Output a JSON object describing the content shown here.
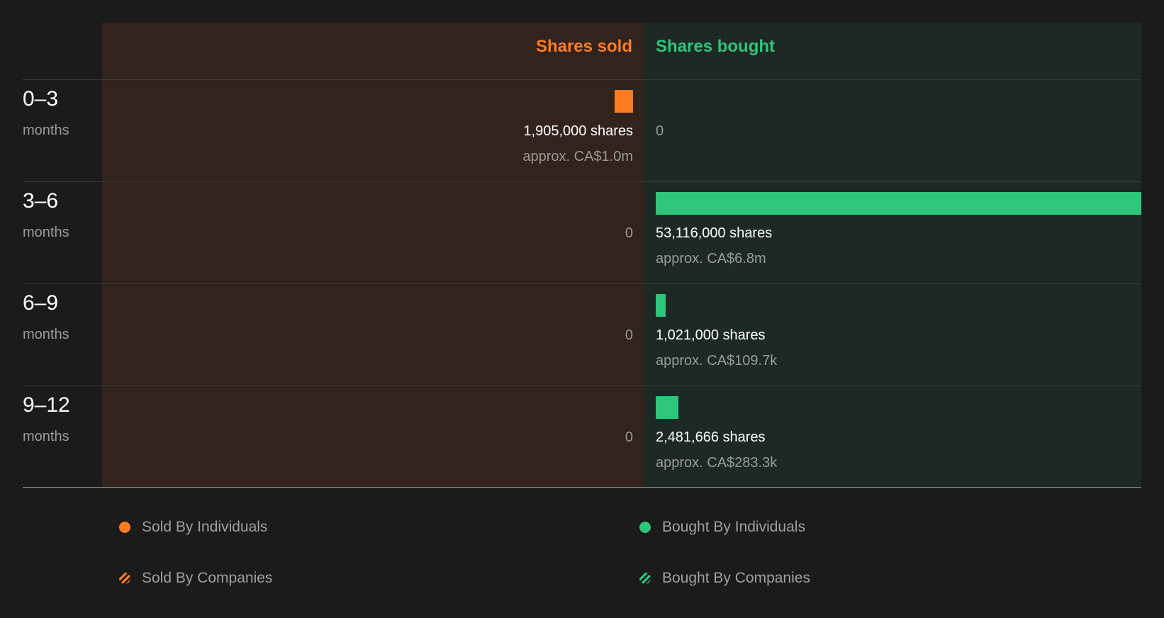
{
  "chart_data": {
    "type": "bar",
    "categories": [
      "0-3",
      "3-6",
      "6-9",
      "9-12"
    ],
    "category_unit": "months",
    "series": [
      {
        "name": "Shares sold",
        "values": [
          1905000,
          0,
          0,
          0
        ],
        "approx_values": [
          "approx. CA$1.0m",
          "",
          "",
          ""
        ]
      },
      {
        "name": "Shares bought",
        "values": [
          0,
          53116000,
          1021000,
          2481666
        ],
        "approx_values": [
          "",
          "approx. CA$6.8m",
          "approx. CA$109.7k",
          "approx. CA$283.3k"
        ]
      }
    ],
    "value_labels": {
      "sold": [
        "1,905,000 shares",
        "0",
        "0",
        "0"
      ],
      "bought": [
        "0",
        "53,116,000 shares",
        "1,021,000 shares",
        "2,481,666 shares"
      ]
    },
    "colors": {
      "sold": "#ff7b22",
      "bought": "#2ec67a",
      "sold_panel": "#32231c",
      "bought_panel": "#1c2924"
    },
    "legend": [
      {
        "label": "Sold By Individuals",
        "color": "#ff7b22",
        "style": "solid"
      },
      {
        "label": "Bought By Individuals",
        "color": "#2ec67a",
        "style": "solid"
      },
      {
        "label": "Sold By Companies",
        "color": "#ff7b22",
        "style": "hatched"
      },
      {
        "label": "Bought By Companies",
        "color": "#2ec67a",
        "style": "hatched"
      }
    ]
  }
}
